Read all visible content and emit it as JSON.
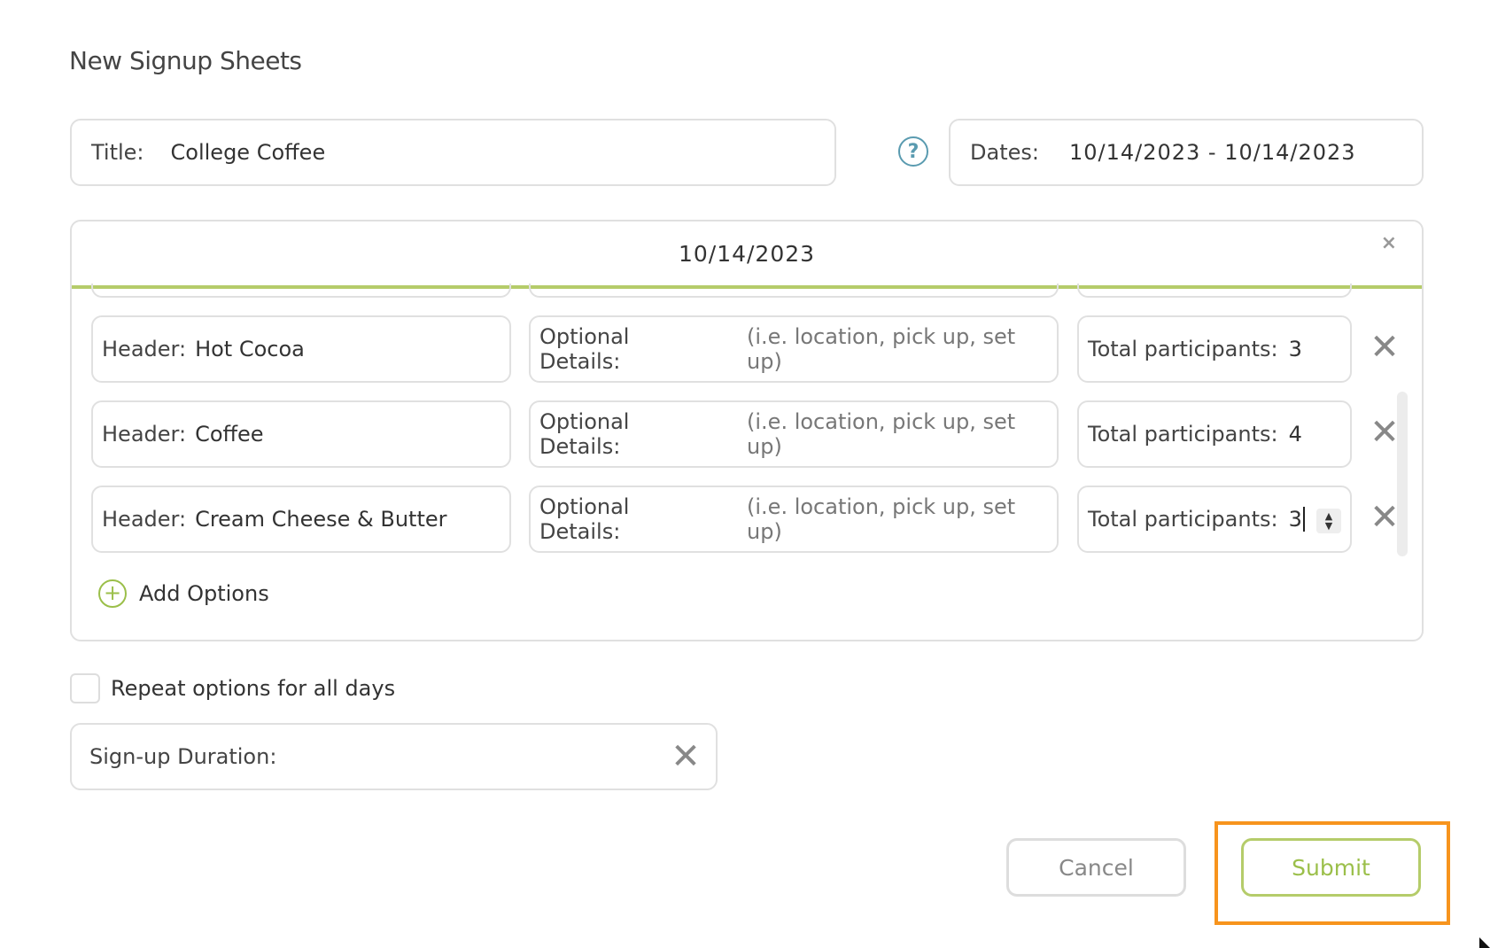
{
  "page": {
    "title": "New Signup Sheets"
  },
  "title_field": {
    "label": "Title:",
    "value": "College Coffee"
  },
  "help": {
    "icon": "question-circle-icon",
    "glyph": "?"
  },
  "dates_field": {
    "label": "Dates:",
    "value": "10/14/2023 - 10/14/2023"
  },
  "day_panel": {
    "date": "10/14/2023",
    "close_glyph": "×",
    "options": [
      {
        "header_label": "Header:",
        "header_value": "Hot Cocoa",
        "details_label": "Optional Details:",
        "details_placeholder": "(i.e. location, pick up, set up)",
        "participants_label": "Total participants:",
        "participants_value": "3"
      },
      {
        "header_label": "Header:",
        "header_value": "Coffee",
        "details_label": "Optional Details:",
        "details_placeholder": "(i.e. location, pick up, set up)",
        "participants_label": "Total participants:",
        "participants_value": "4"
      },
      {
        "header_label": "Header:",
        "header_value": "Cream Cheese & Butter",
        "details_label": "Optional Details:",
        "details_placeholder": "(i.e. location, pick up, set up)",
        "participants_label": "Total participants:",
        "participants_value": "3"
      }
    ],
    "remove_glyph": "✕",
    "add_options_label": "Add Options",
    "add_glyph": "+"
  },
  "repeat_option": {
    "label": "Repeat options for all days",
    "checked": false
  },
  "duration_field": {
    "label": "Sign-up Duration:",
    "clear_glyph": "✕"
  },
  "actions": {
    "cancel_label": "Cancel",
    "submit_label": "Submit"
  },
  "colors": {
    "accent_green": "#b5cc6a",
    "help_blue": "#5a9bb0",
    "highlight_orange": "#f7941d"
  }
}
